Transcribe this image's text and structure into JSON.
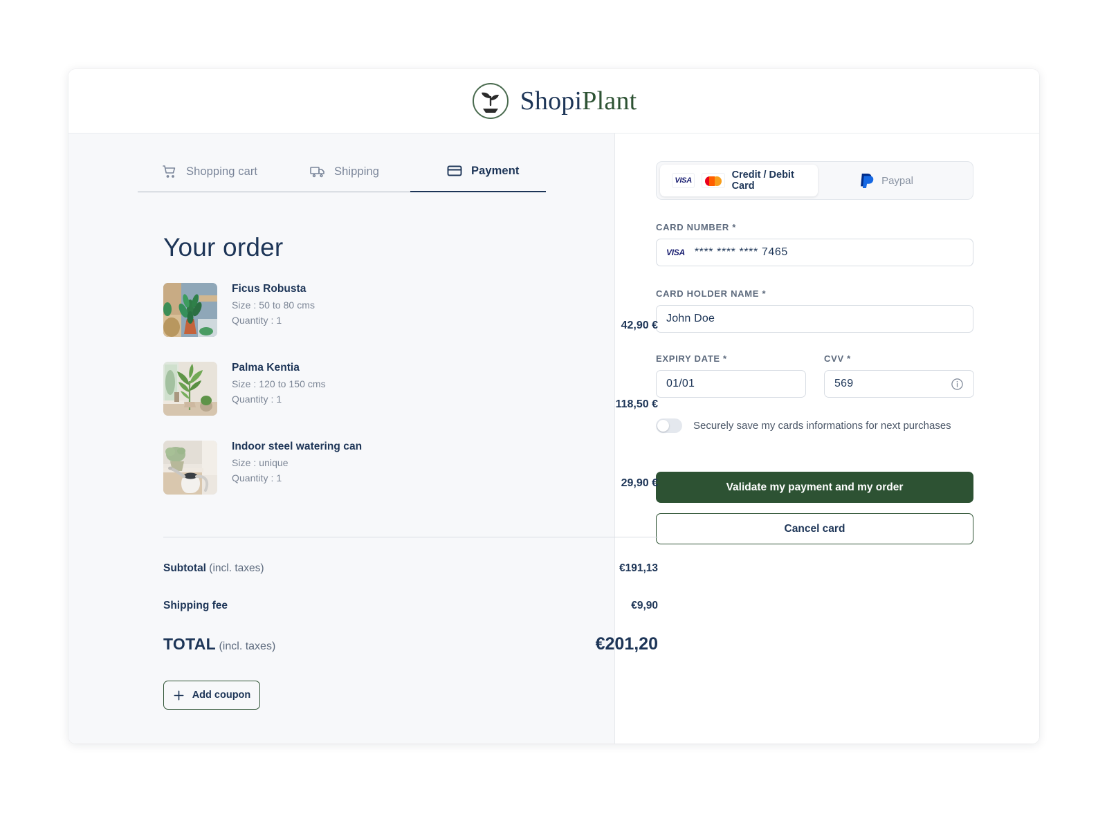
{
  "brand": {
    "name_part1": "Shopi",
    "name_part2": "Plant"
  },
  "steps": [
    {
      "label": "Shopping cart",
      "icon": "shopping-cart-icon",
      "active": false
    },
    {
      "label": "Shipping",
      "icon": "truck-icon",
      "active": false
    },
    {
      "label": "Payment",
      "icon": "credit-card-icon",
      "active": true
    }
  ],
  "order": {
    "title": "Your order",
    "items": [
      {
        "name": "Ficus Robusta",
        "size": "Size : 50 to 80 cms",
        "quantity": "Quantity : 1",
        "price": "42,90 €",
        "thumb": "ficus-plant-photo"
      },
      {
        "name": "Palma Kentia",
        "size": "Size : 120 to 150 cms",
        "quantity": "Quantity : 1",
        "price": "118,50 €",
        "thumb": "palm-plant-photo"
      },
      {
        "name": "Indoor steel watering can",
        "size": "Size : unique",
        "quantity": "Quantity : 1",
        "price": "29,90 €",
        "thumb": "watering-can-photo"
      }
    ],
    "subtotal_label": "Subtotal",
    "subtotal_note": " (incl. taxes)",
    "subtotal_value": "€191,13",
    "shipping_label": "Shipping fee",
    "shipping_value": "€9,90",
    "total_label": "TOTAL",
    "total_note": " (incl. taxes)",
    "total_value": "€201,20",
    "coupon_label": "Add coupon"
  },
  "payment": {
    "tabs": [
      {
        "label": "Credit / Debit Card",
        "active": true
      },
      {
        "label": "Paypal",
        "active": false
      }
    ],
    "card_number_label": "CARD NUMBER *",
    "card_number_value": "**** **** **** 7465",
    "card_brand": "VISA",
    "card_holder_label": "CARD HOLDER NAME *",
    "card_holder_value": "John Doe",
    "expiry_label": "EXPIRY DATE *",
    "expiry_value": "01/01",
    "cvv_label": "CVV *",
    "cvv_value": "569",
    "save_cards_text": "Securely save my cards informations for next purchases",
    "save_cards_enabled": false,
    "validate_label": "Validate my payment and my order",
    "cancel_label": "Cancel card"
  },
  "colors": {
    "navy": "#1d3557",
    "green": "#2d5233",
    "panel_bg": "#f7f8fa",
    "muted": "#7b8595"
  }
}
